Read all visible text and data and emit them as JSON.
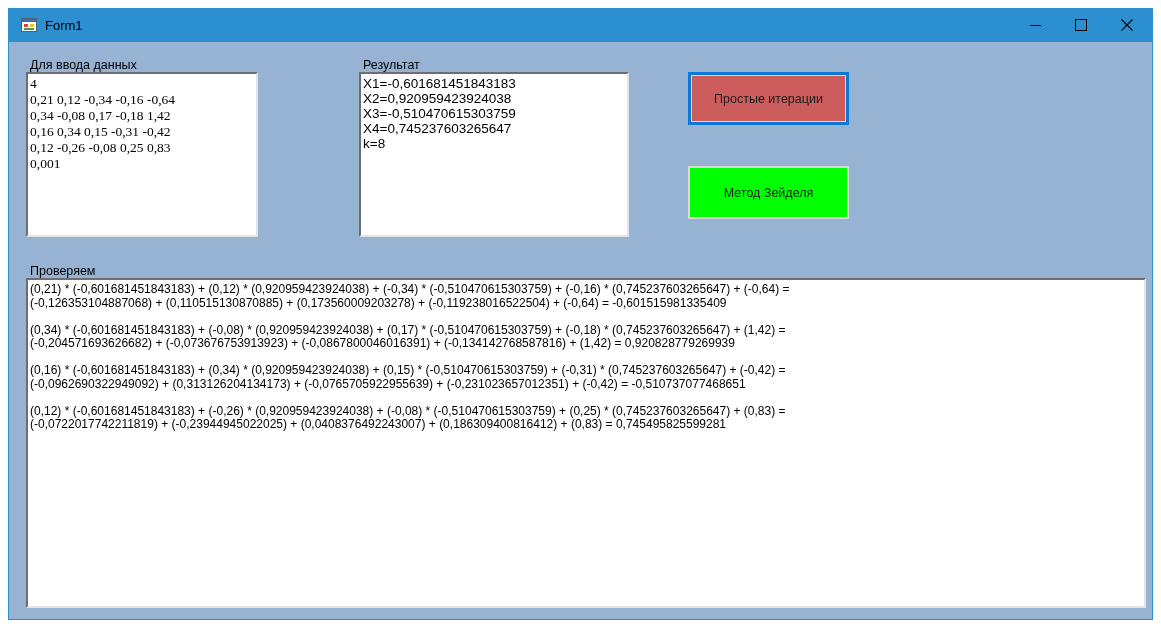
{
  "window": {
    "title": "Form1"
  },
  "input": {
    "label": "Для ввода данных",
    "lines": [
      "4",
      "0,21 0,12 -0,34 -0,16 -0,64",
      "0,34 -0,08 0,17 -0,18 1,42",
      "0,16 0,34 0,15 -0,31 -0,42",
      "0,12 -0,26 -0,08 0,25 0,83",
      "0,001"
    ]
  },
  "result": {
    "label": "Результат",
    "lines": [
      "X1=-0,601681451843183",
      "X2=0,920959423924038",
      "X3=-0,510470615303759",
      "X4=0,745237603265647",
      "k=8"
    ]
  },
  "buttons": [
    {
      "label": "Простые итерации",
      "color": "#cd5c5c",
      "focused": true
    },
    {
      "label": "Метод Зейделя",
      "color": "#00ff00",
      "focused": false
    }
  ],
  "check": {
    "label": "Проверяем",
    "blocks": [
      [
        "(0,21) * (-0,601681451843183) + (0,12) * (0,920959423924038) + (-0,34) * (-0,510470615303759) + (-0,16) * (0,745237603265647) + (-0,64) =",
        "(-0,126353104887068) + (0,110515130870885) + (0,173560009203278) + (-0,119238016522504) + (-0,64) = -0,601515981335409"
      ],
      [
        "(0,34) * (-0,601681451843183) + (-0,08) * (0,920959423924038) + (0,17) * (-0,510470615303759) + (-0,18) * (0,745237603265647) + (1,42) =",
        "(-0,204571693626682) + (-0,073676753913923) + (-0,0867800046016391) + (-0,134142768587816) + (1,42) = 0,920828779269939"
      ],
      [
        "(0,16) * (-0,601681451843183) + (0,34) * (0,920959423924038) + (0,15) * (-0,510470615303759) + (-0,31) * (0,745237603265647) + (-0,42) =",
        "(-0,0962690322949092) + (0,313126204134173) + (-0,0765705922955639) + (-0,231023657012351) + (-0,42) = -0,510737077468651"
      ],
      [
        "(0,12) * (-0,601681451843183) + (-0,26) * (0,920959423924038) + (-0,08) * (-0,510470615303759) + (0,25) * (0,745237603265647) + (0,83) =",
        "(-0,0722017742211819) + (-0,23944945022025) + (0,0408376492243007) + (0,186309400816412) + (0,83) = 0,745495825599281"
      ]
    ]
  }
}
